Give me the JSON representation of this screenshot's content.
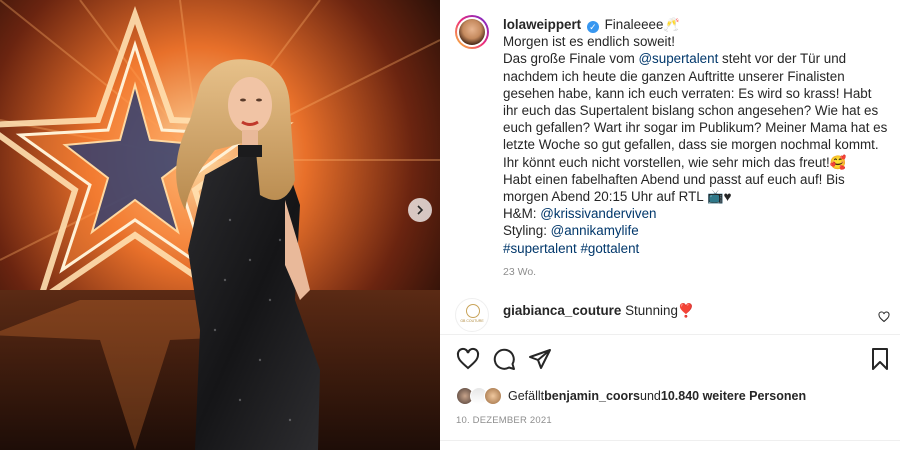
{
  "post": {
    "username": "lolaweippert",
    "caption_lines": [
      "Finaleeee🥂",
      "Morgen ist es endlich soweit!",
      "Das große Finale vom ",
      "@supertalent",
      " steht vor der Tür und nachdem ich heute die ganzen Auftritte unserer Finalisten gesehen habe, kann ich euch verraten: Es wird so krass! Habt ihr euch das Supertalent bislang schon angesehen? Wie hat es euch gefallen? Wart ihr sogar im Publikum? Meiner Mama hat es letzte Woche so gut gefallen, dass sie morgen nochmal kommt. Ihr könnt euch nicht vorstellen, wie sehr mich das freut!🥰",
      "Habt einen fabelhaften Abend und passt auf euch auf! Bis morgen Abend 20:15 Uhr auf RTL 📺♥",
      "H&M: ",
      "@krissivanderviven",
      "Styling: ",
      "@annikamylife",
      "#supertalent",
      "#gottalent"
    ],
    "time_ago": "23 Wo."
  },
  "comment": {
    "username": "giabianca_couture",
    "text": "Stunning❣️",
    "avatar_label": "GB COUTURE"
  },
  "likes": {
    "prefix": "Gefällt ",
    "user": "benjamin_coors",
    "middle": " und ",
    "count": "10.840 weitere Personen"
  },
  "date": "10. DEZEMBER 2021",
  "icons": {
    "like": "heart-icon",
    "comment": "comment-icon",
    "share": "share-icon",
    "save": "bookmark-icon",
    "next": "chevron-right-icon",
    "verified": "verified-badge-icon"
  },
  "colors": {
    "link": "#00376b",
    "verified": "#3897f0",
    "muted": "#8e8e8e"
  }
}
